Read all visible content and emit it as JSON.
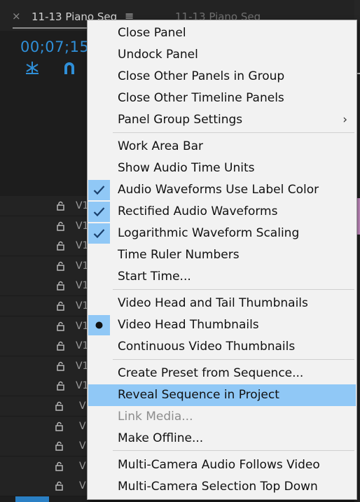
{
  "tab": {
    "close": "×",
    "title": "11-13 Piano Seq",
    "menu_icon": "≡",
    "title2": "11-13 Piano Seq"
  },
  "timecode": "00;07;15;",
  "tracks": [
    "V1",
    "V1",
    "V1",
    "V1",
    "V1",
    "V1",
    "V1",
    "V1",
    "V1",
    "V1",
    "V",
    "V",
    "V",
    "V",
    "V"
  ],
  "menu": {
    "items": [
      {
        "label": "Close Panel"
      },
      {
        "label": "Undock Panel"
      },
      {
        "label": "Close Other Panels in Group"
      },
      {
        "label": "Close Other Timeline Panels"
      },
      {
        "label": "Panel Group Settings",
        "submenu_arrow": "›"
      },
      {
        "label": "Work Area Bar"
      },
      {
        "label": "Show Audio Time Units"
      },
      {
        "label": "Audio Waveforms Use Label Color",
        "checked": true
      },
      {
        "label": "Rectified Audio Waveforms",
        "checked": true
      },
      {
        "label": "Logarithmic Waveform Scaling",
        "checked": true
      },
      {
        "label": "Time Ruler Numbers"
      },
      {
        "label": "Start Time..."
      },
      {
        "label": "Video Head and Tail Thumbnails"
      },
      {
        "label": "Video Head Thumbnails",
        "selected_radio": true
      },
      {
        "label": "Continuous Video Thumbnails"
      },
      {
        "label": "Create Preset from Sequence..."
      },
      {
        "label": "Reveal Sequence in Project",
        "highlighted": true
      },
      {
        "label": "Link Media...",
        "disabled": true
      },
      {
        "label": "Make Offline..."
      },
      {
        "label": "Multi-Camera Audio Follows Video"
      },
      {
        "label": "Multi-Camera Selection Top Down"
      }
    ]
  },
  "colors": {
    "menu_bg": "#f2f2f2",
    "highlight": "#90c8f6",
    "timecode": "#2f8fd8",
    "panel_bg": "#1d1d1d"
  }
}
